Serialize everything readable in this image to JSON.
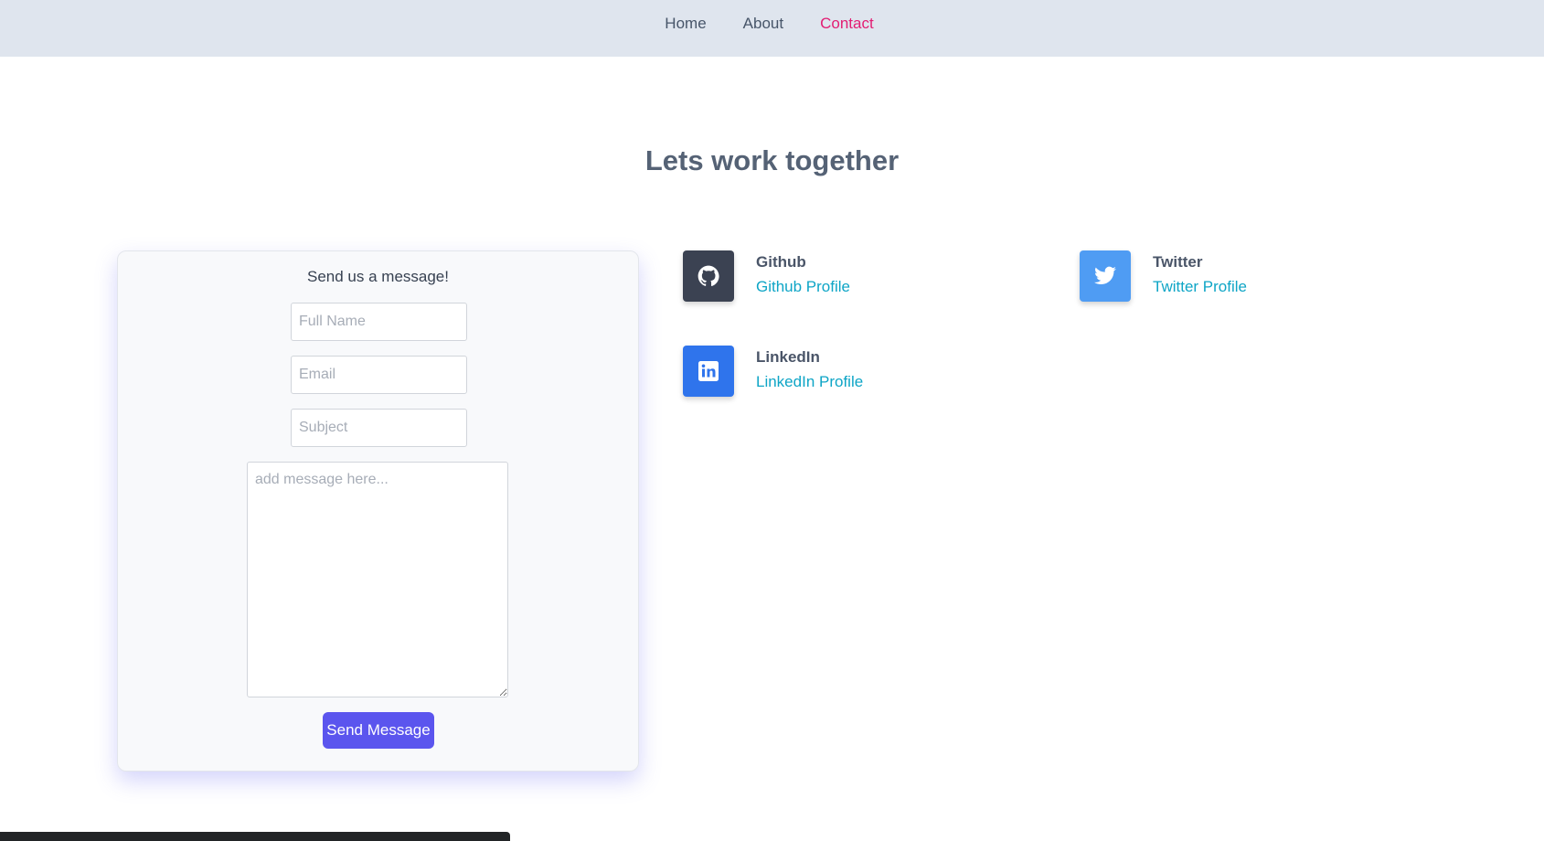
{
  "nav": {
    "items": [
      {
        "label": "Home"
      },
      {
        "label": "About"
      },
      {
        "label": "Contact"
      }
    ],
    "active": "Contact",
    "active_color": "#e21d73"
  },
  "page": {
    "heading": "Lets work together"
  },
  "form": {
    "title": "Send us a message!",
    "name_placeholder": "Full Name",
    "email_placeholder": "Email",
    "subject_placeholder": "Subject",
    "message_placeholder": "add message here...",
    "submit_label": "Send Message",
    "submit_color": "#5b55ee"
  },
  "socials": {
    "github": {
      "name": "Github",
      "link": "Github Profile",
      "icon": "github-icon",
      "color": "#3b4252"
    },
    "twitter": {
      "name": "Twitter",
      "link": "Twitter Profile",
      "icon": "twitter-icon",
      "color": "#4f9cf3"
    },
    "linkedin": {
      "name": "LinkedIn",
      "link": "LinkedIn Profile",
      "icon": "linkedin-icon",
      "color": "#2f74ec"
    }
  }
}
